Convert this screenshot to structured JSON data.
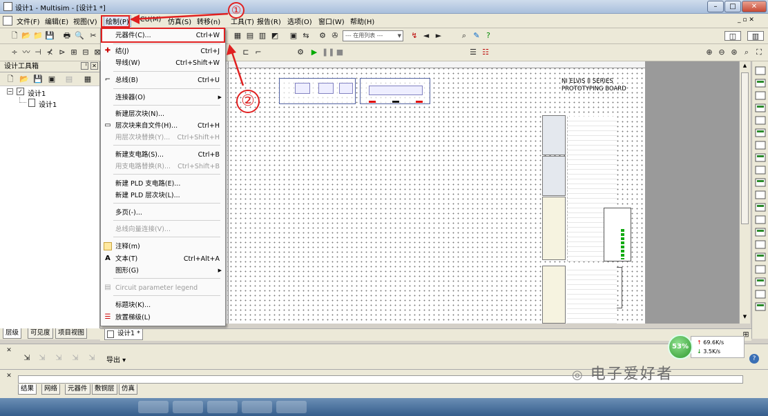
{
  "window": {
    "title": "设计1 - Multisim - [设计1 *]"
  },
  "menubar": {
    "items": [
      "文件(F)",
      "编辑(E)",
      "视图(V)",
      "绘制(P)",
      "MCU(M)",
      "仿真(S)",
      "转移(n)",
      "工具(T)",
      "报告(R)",
      "选项(O)",
      "窗口(W)",
      "帮助(H)"
    ]
  },
  "toolbar": {
    "in_use_list": "--- 在用列表 ---"
  },
  "design_toolbox": {
    "title": "设计工具箱",
    "tree": {
      "root": "设计1",
      "child": "设计1"
    },
    "tabs": [
      "层级",
      "可见度",
      "项目视图"
    ]
  },
  "draw_menu": {
    "items": [
      {
        "label": "元器件(C)...",
        "shortcut": "Ctrl+W",
        "icon": "",
        "disabled": false
      },
      {
        "label": "结(J)",
        "shortcut": "Ctrl+J",
        "icon": "junction-icon",
        "disabled": false
      },
      {
        "label": "导线(W)",
        "shortcut": "Ctrl+Shift+W",
        "icon": "",
        "disabled": false
      },
      {
        "label": "总线(B)",
        "shortcut": "Ctrl+U",
        "icon": "bus-icon",
        "disabled": false
      },
      {
        "label": "连接器(O)",
        "shortcut": "",
        "icon": "",
        "disabled": false,
        "submenu": true
      },
      {
        "label": "新建层次块(N)...",
        "shortcut": "",
        "icon": "",
        "disabled": false
      },
      {
        "label": "层次块来自文件(H)...",
        "shortcut": "Ctrl+H",
        "icon": "hier-block-icon",
        "disabled": false
      },
      {
        "label": "用层次块替换(Y)...",
        "shortcut": "Ctrl+Shift+H",
        "icon": "",
        "disabled": true
      },
      {
        "label": "新建支电路(S)...",
        "shortcut": "Ctrl+B",
        "icon": "",
        "disabled": false
      },
      {
        "label": "用支电路替换(R)...",
        "shortcut": "Ctrl+Shift+B",
        "icon": "",
        "disabled": true
      },
      {
        "label": "新建 PLD 支电路(E)...",
        "shortcut": "",
        "icon": "",
        "disabled": false
      },
      {
        "label": "新建 PLD 层次块(L)...",
        "shortcut": "",
        "icon": "",
        "disabled": false
      },
      {
        "label": "多页(-)...",
        "shortcut": "",
        "icon": "",
        "disabled": false
      },
      {
        "label": "总线向量连接(V)...",
        "shortcut": "",
        "icon": "",
        "disabled": true
      },
      {
        "label": "注释(m)",
        "shortcut": "",
        "icon": "comment-icon",
        "disabled": false
      },
      {
        "label": "文本(T)",
        "shortcut": "Ctrl+Alt+A",
        "icon": "text-icon",
        "disabled": false
      },
      {
        "label": "图形(G)",
        "shortcut": "",
        "icon": "",
        "disabled": false,
        "submenu": true
      },
      {
        "label": "Circuit parameter legend",
        "shortcut": "",
        "icon": "legend-icon",
        "disabled": true
      },
      {
        "label": "标题块(K)...",
        "shortcut": "",
        "icon": "",
        "disabled": false
      },
      {
        "label": "放置梯级(L)",
        "shortcut": "",
        "icon": "rung-icon",
        "disabled": false
      }
    ]
  },
  "annotations": {
    "step1": "①",
    "step2": "②"
  },
  "board": {
    "line1": "NI ELVIS II SERIES",
    "line2": "PROTOTYPING BOARD"
  },
  "doc_tab": {
    "label": "设计1 *"
  },
  "spreadsheet": {
    "export_label": "导出"
  },
  "bottom_tabs": [
    "结果",
    "网络",
    "元器件",
    "敷铜层",
    "仿真"
  ],
  "net_speed": {
    "percent": "53%",
    "up": "69.6K/s",
    "down": "3.5K/s"
  },
  "watermark": "电子爱好者",
  "colors": {
    "highlight": "#e02020",
    "titlebar": "#a9bfdc"
  }
}
